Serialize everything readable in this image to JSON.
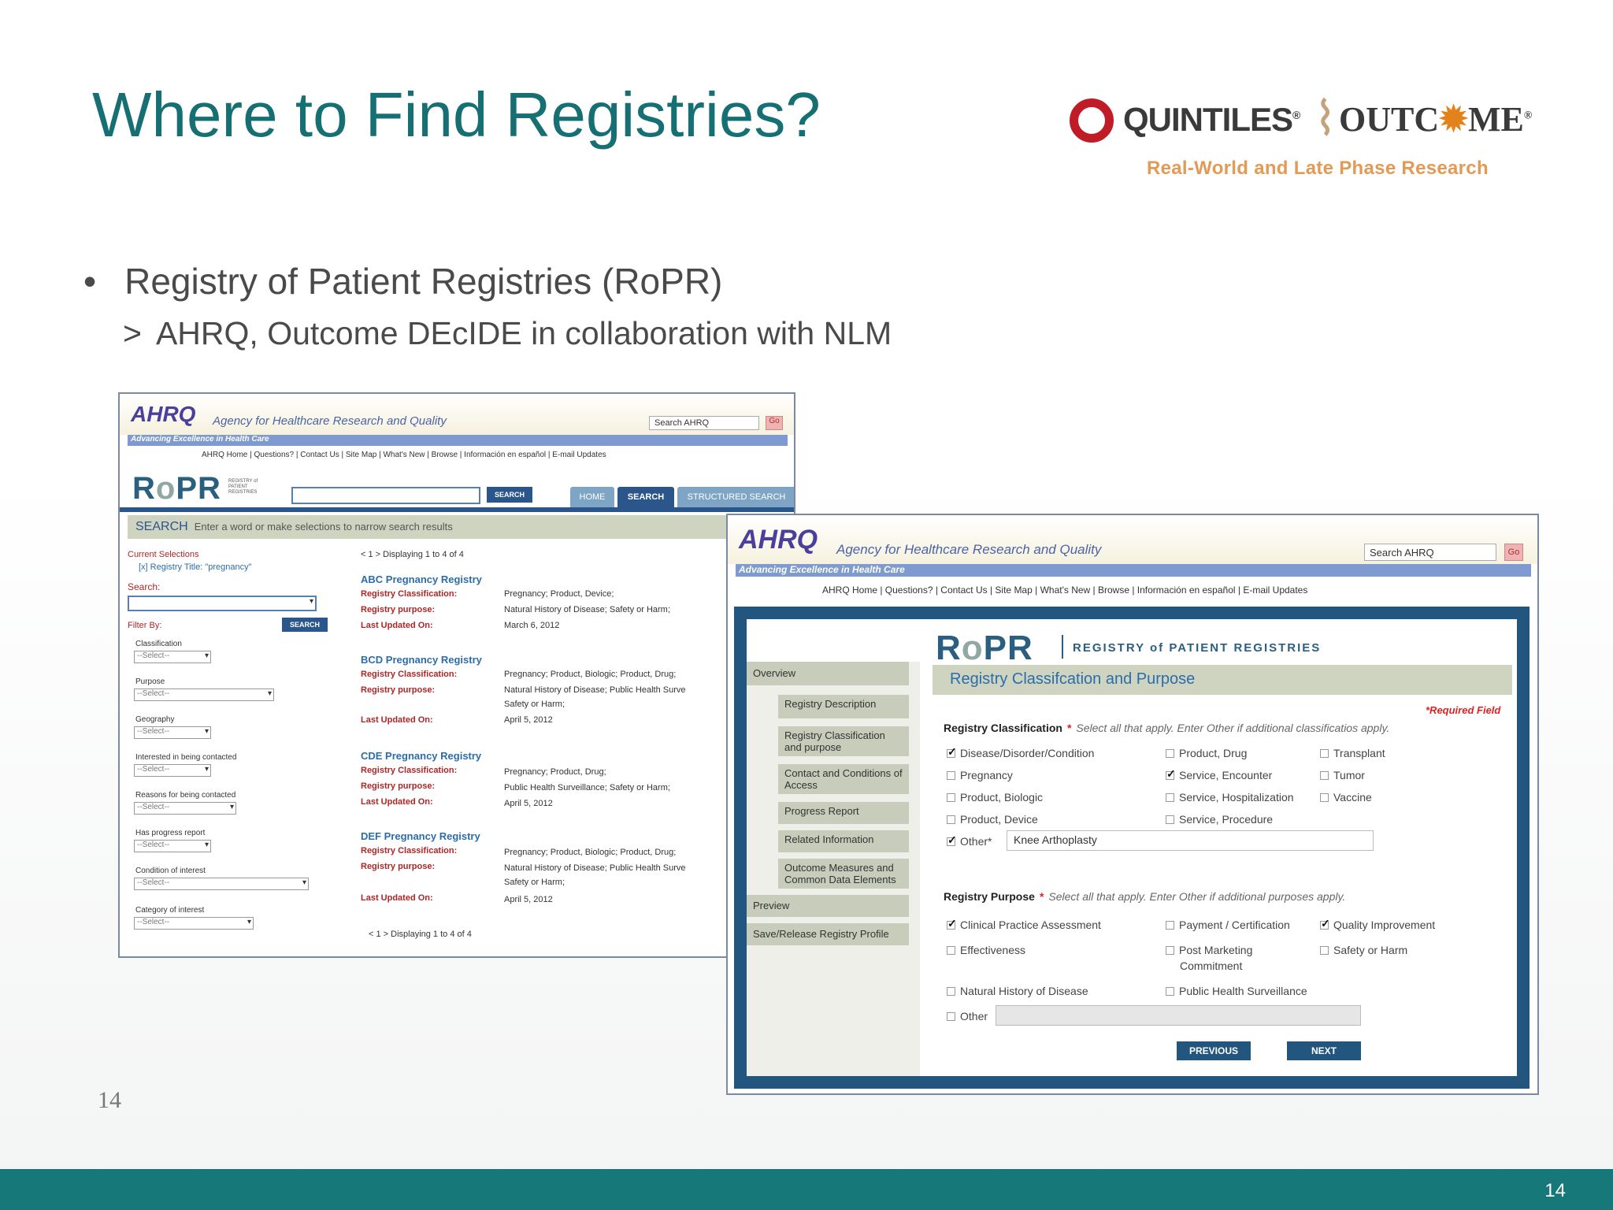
{
  "slide": {
    "title": "Where to Find Registries?",
    "bullet": "Registry of Patient Registries (RoPR)",
    "subbullet": "AHRQ, Outcome DEcIDE in collaboration with NLM",
    "page_number_left": "14",
    "page_number_footer": "14",
    "footer_color": "#17787a",
    "title_color": "#166f72"
  },
  "logo": {
    "quintiles": "QUINTILES",
    "outcome_pre": "OUTC",
    "outcome_post": "ME",
    "registered": "®",
    "tagline": "Real-World and Late Phase Research"
  },
  "shot1": {
    "ahrq_logo": "AHRQ",
    "ahrq_name": "Agency for Healthcare Research and Quality",
    "search_ahrq": "Search AHRQ",
    "go": "Go",
    "strip": "Advancing Excellence in Health Care",
    "links": "AHRQ Home  |  Questions?  |  Contact Us  |  Site Map  |  What's New  |  Browse  |  Información en español  |  E-mail Updates",
    "ropr": "RoPR",
    "ropr_small": "REGISTRY of PATIENT REGISTRIES",
    "search_button": "SEARCH",
    "tabs": [
      "HOME",
      "SEARCH",
      "STRUCTURED SEARCH"
    ],
    "searchbar_title": "SEARCH",
    "searchbar_hint": "Enter a word or make selections to narrow search results",
    "current_selections": "Current Selections",
    "selection_item": "[x] Registry Title: \"pregnancy\"",
    "search_label": "Search:",
    "filter_by": "Filter By:",
    "filter_button": "SEARCH",
    "select_placeholder": "--Select--",
    "filters": [
      "Classification",
      "Purpose",
      "Geography",
      "Interested in being contacted",
      "Reasons for being contacted",
      "Has progress report",
      "Condition of interest",
      "Category of interest"
    ],
    "paging": "< 1 > Displaying 1 to 4 of 4",
    "results": [
      {
        "title": "ABC Pregnancy Registry",
        "rows": [
          {
            "k": "Registry Classification:",
            "v": "Pregnancy; Product, Device;"
          },
          {
            "k": "Registry purpose:",
            "v": "Natural History of Disease; Safety or Harm;"
          },
          {
            "k": "Last Updated On:",
            "v": "March 6, 2012"
          }
        ]
      },
      {
        "title": "BCD Pregnancy Registry",
        "rows": [
          {
            "k": "Registry Classification:",
            "v": "Pregnancy; Product, Biologic; Product, Drug;"
          },
          {
            "k": "Registry purpose:",
            "v": "Natural History of Disease; Public Health Surve"
          },
          {
            "k": "",
            "v": "Safety or Harm;"
          },
          {
            "k": "Last Updated On:",
            "v": "April 5, 2012"
          }
        ]
      },
      {
        "title": "CDE Pregnancy Registry",
        "rows": [
          {
            "k": "Registry Classification:",
            "v": "Pregnancy; Product, Drug;"
          },
          {
            "k": "Registry purpose:",
            "v": "Public Health Surveillance; Safety or Harm;"
          },
          {
            "k": "Last Updated On:",
            "v": "April 5, 2012"
          }
        ]
      },
      {
        "title": "DEF Pregnancy Registry",
        "rows": [
          {
            "k": "Registry Classification:",
            "v": "Pregnancy; Product, Biologic; Product, Drug;"
          },
          {
            "k": "Registry purpose:",
            "v": "Natural History of Disease; Public Health Surve"
          },
          {
            "k": "",
            "v": "Safety or Harm;"
          },
          {
            "k": "Last Updated On:",
            "v": "April 5, 2012"
          }
        ]
      }
    ]
  },
  "shot2": {
    "ahrq_logo": "AHRQ",
    "ahrq_name": "Agency for Healthcare Research and Quality",
    "search_ahrq": "Search AHRQ",
    "go": "Go",
    "strip": "Advancing Excellence in Health Care",
    "links": "AHRQ Home  |  Questions?  |  Contact Us  |  Site Map  |  What's New  |  Browse  |  Información en español  |  E-mail Updates",
    "ropr": "RoPR",
    "ropr_sub": "REGISTRY of PATIENT REGISTRIES",
    "nav": [
      "Overview",
      "Registry Description",
      "Registry Classification and purpose",
      "Contact and Conditions of Access",
      "Progress Report",
      "Related Information",
      "Outcome Measures and Common Data Elements",
      "Preview",
      "Save/Release Registry Profile"
    ],
    "section_title": "Registry Classifcation and Purpose",
    "required": "*Required Field",
    "classification_label": "Registry Classification",
    "classification_hint": "Select all that apply. Enter Other if additional classificatios apply.",
    "classification_options": [
      {
        "label": "Disease/Disorder/Condition",
        "checked": true
      },
      {
        "label": "Pregnancy",
        "checked": false
      },
      {
        "label": "Product, Biologic",
        "checked": false
      },
      {
        "label": "Product, Device",
        "checked": false
      },
      {
        "label": "Other*",
        "checked": true
      },
      {
        "label": "Product, Drug",
        "checked": false
      },
      {
        "label": "Service, Encounter",
        "checked": true
      },
      {
        "label": "Service, Hospitalization",
        "checked": false
      },
      {
        "label": "Service, Procedure",
        "checked": false
      },
      {
        "label": "Transplant",
        "checked": false
      },
      {
        "label": "Tumor",
        "checked": false
      },
      {
        "label": "Vaccine",
        "checked": false
      }
    ],
    "other_value": "Knee Arthoplasty",
    "purpose_label": "Registry Purpose",
    "purpose_hint": "Select all that apply. Enter Other if additional purposes apply.",
    "purpose_options": [
      {
        "label": "Clinical Practice Assessment",
        "checked": true
      },
      {
        "label": "Effectiveness",
        "checked": false
      },
      {
        "label": "Natural History of Disease",
        "checked": false
      },
      {
        "label": "Other",
        "checked": false
      },
      {
        "label": "Payment / Certification",
        "checked": false
      },
      {
        "label": "Post Marketing",
        "checked": false
      },
      {
        "label": "Commitment",
        "checked": false
      },
      {
        "label": "Public Health Surveillance",
        "checked": false
      },
      {
        "label": "Quality Improvement",
        "checked": true
      },
      {
        "label": "Safety or Harm",
        "checked": false
      }
    ],
    "previous": "PREVIOUS",
    "next": "NEXT"
  }
}
